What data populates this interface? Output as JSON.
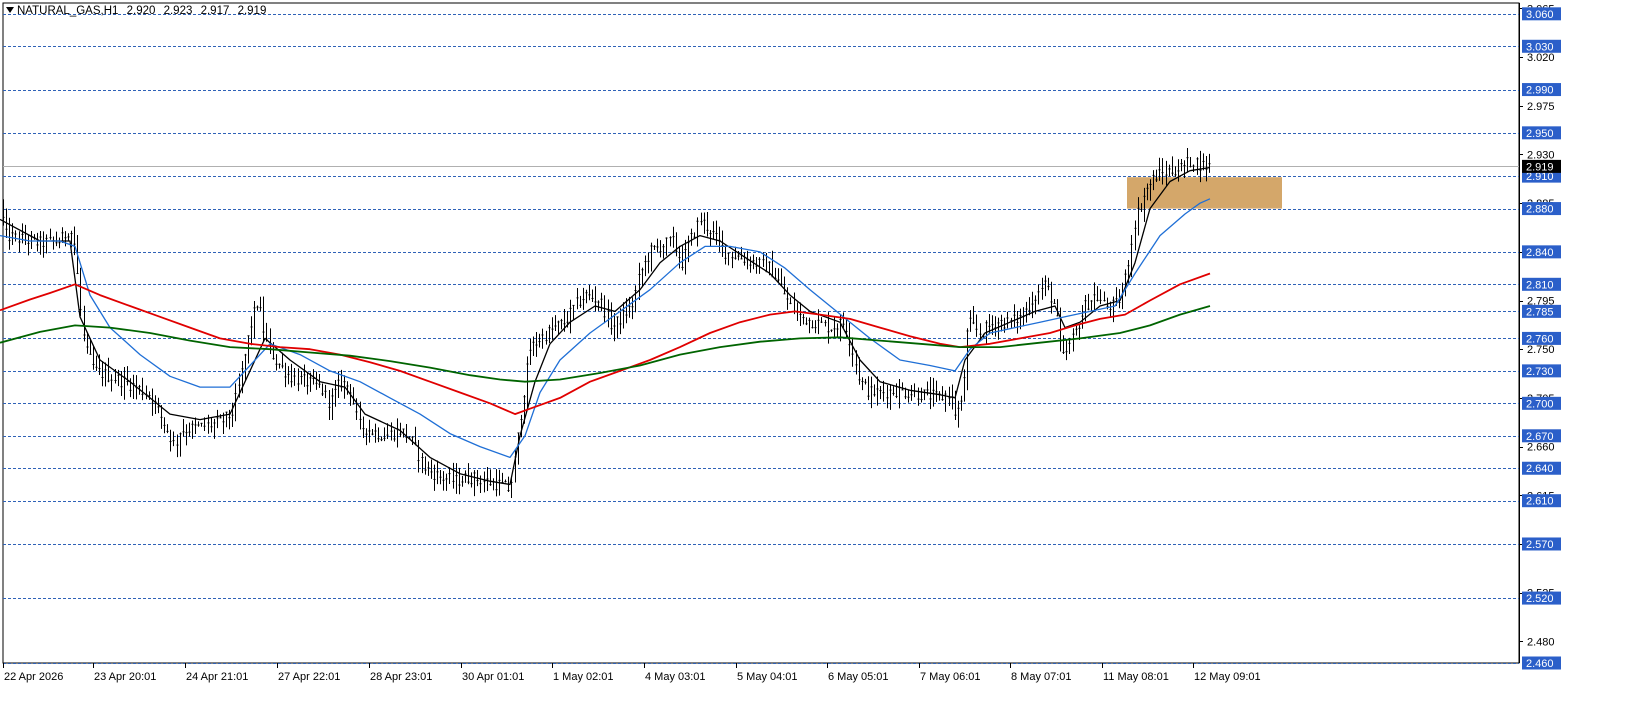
{
  "header": {
    "symbol_timeframe": "NATURAL_GAS,H1",
    "open": "2.920",
    "high": "2.923",
    "low": "2.917",
    "close": "2.919"
  },
  "colors": {
    "background": "#ffffff",
    "candles": "#000000",
    "ma_fast": "#000000",
    "ma_mid": "#1f6fd6",
    "ma_slow": "#e00000",
    "ma_long": "#006400",
    "level_lines": "#2f62b7",
    "level_label_bg": "#2b5fc9",
    "current_price_bg": "#000000",
    "zone_fill": "#d4a76a"
  },
  "chart_data": {
    "type": "candlestick",
    "ylim": [
      2.46,
      3.07
    ],
    "x_tick_labels": [
      "22 Apr 2026",
      "23 Apr 20:01",
      "24 Apr 21:01",
      "27 Apr 22:01",
      "28 Apr 23:01",
      "30 Apr 01:01",
      "1 May 02:01",
      "4 May 03:01",
      "5 May 04:01",
      "6 May 05:01",
      "7 May 06:01",
      "8 May 07:01",
      "11 May 08:01",
      "12 May 09:01"
    ],
    "y_tick_labels": [
      "3.065",
      "3.020",
      "2.975",
      "2.930",
      "2.885",
      "2.840",
      "2.795",
      "2.750",
      "2.705",
      "2.660",
      "2.615",
      "2.570",
      "2.525",
      "2.480"
    ],
    "level_labels": [
      "3.060",
      "3.030",
      "2.990",
      "2.950",
      "2.910",
      "2.880",
      "2.840",
      "2.810",
      "2.785",
      "2.760",
      "2.730",
      "2.700",
      "2.670",
      "2.640",
      "2.610",
      "2.570",
      "2.520",
      "2.460"
    ],
    "current_price": "2.919",
    "zone": {
      "x_from": 1127,
      "x_to": 1282,
      "y_from": 2.88,
      "y_to": 2.909
    },
    "price_anchors": [
      [
        0,
        2.885
      ],
      [
        6,
        2.855
      ],
      [
        20,
        2.852
      ],
      [
        40,
        2.848
      ],
      [
        60,
        2.85
      ],
      [
        70,
        2.862
      ],
      [
        75,
        2.845
      ],
      [
        80,
        2.79
      ],
      [
        85,
        2.75
      ],
      [
        95,
        2.73
      ],
      [
        110,
        2.725
      ],
      [
        130,
        2.718
      ],
      [
        150,
        2.708
      ],
      [
        165,
        2.68
      ],
      [
        175,
        2.66
      ],
      [
        180,
        2.675
      ],
      [
        200,
        2.678
      ],
      [
        220,
        2.682
      ],
      [
        232,
        2.69
      ],
      [
        240,
        2.72
      ],
      [
        250,
        2.77
      ],
      [
        258,
        2.795
      ],
      [
        265,
        2.76
      ],
      [
        275,
        2.74
      ],
      [
        290,
        2.725
      ],
      [
        305,
        2.72
      ],
      [
        320,
        2.715
      ],
      [
        330,
        2.7
      ],
      [
        340,
        2.72
      ],
      [
        350,
        2.715
      ],
      [
        358,
        2.68
      ],
      [
        370,
        2.675
      ],
      [
        385,
        2.67
      ],
      [
        400,
        2.675
      ],
      [
        410,
        2.668
      ],
      [
        425,
        2.64
      ],
      [
        440,
        2.632
      ],
      [
        455,
        2.628
      ],
      [
        470,
        2.632
      ],
      [
        485,
        2.628
      ],
      [
        500,
        2.625
      ],
      [
        510,
        2.62
      ],
      [
        515,
        2.65
      ],
      [
        522,
        2.7
      ],
      [
        530,
        2.75
      ],
      [
        540,
        2.76
      ],
      [
        555,
        2.77
      ],
      [
        565,
        2.775
      ],
      [
        575,
        2.79
      ],
      [
        585,
        2.8
      ],
      [
        600,
        2.795
      ],
      [
        612,
        2.77
      ],
      [
        622,
        2.78
      ],
      [
        632,
        2.79
      ],
      [
        640,
        2.82
      ],
      [
        650,
        2.84
      ],
      [
        660,
        2.845
      ],
      [
        672,
        2.85
      ],
      [
        682,
        2.83
      ],
      [
        690,
        2.85
      ],
      [
        700,
        2.87
      ],
      [
        710,
        2.86
      ],
      [
        725,
        2.84
      ],
      [
        740,
        2.835
      ],
      [
        755,
        2.83
      ],
      [
        770,
        2.825
      ],
      [
        780,
        2.81
      ],
      [
        790,
        2.79
      ],
      [
        800,
        2.78
      ],
      [
        815,
        2.775
      ],
      [
        830,
        2.77
      ],
      [
        845,
        2.775
      ],
      [
        852,
        2.75
      ],
      [
        860,
        2.72
      ],
      [
        870,
        2.71
      ],
      [
        880,
        2.71
      ],
      [
        895,
        2.712
      ],
      [
        910,
        2.71
      ],
      [
        925,
        2.708
      ],
      [
        940,
        2.705
      ],
      [
        950,
        2.71
      ],
      [
        955,
        2.69
      ],
      [
        962,
        2.7
      ],
      [
        968,
        2.775
      ],
      [
        980,
        2.765
      ],
      [
        995,
        2.775
      ],
      [
        1010,
        2.775
      ],
      [
        1022,
        2.78
      ],
      [
        1032,
        2.795
      ],
      [
        1045,
        2.81
      ],
      [
        1055,
        2.79
      ],
      [
        1062,
        2.74
      ],
      [
        1068,
        2.75
      ],
      [
        1075,
        2.765
      ],
      [
        1085,
        2.79
      ],
      [
        1095,
        2.8
      ],
      [
        1105,
        2.79
      ],
      [
        1115,
        2.79
      ],
      [
        1122,
        2.8
      ],
      [
        1128,
        2.83
      ],
      [
        1135,
        2.87
      ],
      [
        1145,
        2.895
      ],
      [
        1155,
        2.91
      ],
      [
        1170,
        2.915
      ],
      [
        1182,
        2.918
      ],
      [
        1192,
        2.925
      ],
      [
        1202,
        2.92
      ],
      [
        1210,
        2.919
      ]
    ],
    "series": [
      {
        "values": [
          [
            0,
            2.87
          ],
          [
            40,
            2.85
          ],
          [
            70,
            2.85
          ],
          [
            80,
            2.78
          ],
          [
            100,
            2.74
          ],
          [
            130,
            2.72
          ],
          [
            150,
            2.705
          ],
          [
            170,
            2.69
          ],
          [
            200,
            2.685
          ],
          [
            230,
            2.69
          ],
          [
            250,
            2.73
          ],
          [
            265,
            2.76
          ],
          [
            290,
            2.74
          ],
          [
            320,
            2.72
          ],
          [
            345,
            2.715
          ],
          [
            365,
            2.69
          ],
          [
            400,
            2.675
          ],
          [
            430,
            2.65
          ],
          [
            460,
            2.635
          ],
          [
            490,
            2.628
          ],
          [
            510,
            2.625
          ],
          [
            520,
            2.67
          ],
          [
            535,
            2.72
          ],
          [
            550,
            2.755
          ],
          [
            570,
            2.775
          ],
          [
            595,
            2.79
          ],
          [
            615,
            2.785
          ],
          [
            640,
            2.805
          ],
          [
            660,
            2.83
          ],
          [
            680,
            2.845
          ],
          [
            700,
            2.855
          ],
          [
            720,
            2.85
          ],
          [
            745,
            2.835
          ],
          [
            770,
            2.82
          ],
          [
            790,
            2.8
          ],
          [
            810,
            2.785
          ],
          [
            840,
            2.775
          ],
          [
            860,
            2.74
          ],
          [
            880,
            2.72
          ],
          [
            910,
            2.712
          ],
          [
            940,
            2.708
          ],
          [
            955,
            2.705
          ],
          [
            965,
            2.74
          ],
          [
            985,
            2.765
          ],
          [
            1010,
            2.775
          ],
          [
            1035,
            2.785
          ],
          [
            1055,
            2.79
          ],
          [
            1065,
            2.77
          ],
          [
            1080,
            2.775
          ],
          [
            1100,
            2.79
          ],
          [
            1120,
            2.795
          ],
          [
            1135,
            2.83
          ],
          [
            1150,
            2.88
          ],
          [
            1170,
            2.905
          ],
          [
            1190,
            2.915
          ],
          [
            1210,
            2.918
          ]
        ]
      },
      {
        "values": [
          [
            0,
            2.855
          ],
          [
            30,
            2.85
          ],
          [
            60,
            2.85
          ],
          [
            75,
            2.845
          ],
          [
            90,
            2.8
          ],
          [
            110,
            2.77
          ],
          [
            140,
            2.745
          ],
          [
            170,
            2.725
          ],
          [
            200,
            2.715
          ],
          [
            230,
            2.715
          ],
          [
            250,
            2.735
          ],
          [
            270,
            2.755
          ],
          [
            300,
            2.745
          ],
          [
            330,
            2.73
          ],
          [
            360,
            2.72
          ],
          [
            390,
            2.705
          ],
          [
            420,
            2.69
          ],
          [
            450,
            2.672
          ],
          [
            480,
            2.66
          ],
          [
            510,
            2.65
          ],
          [
            525,
            2.67
          ],
          [
            540,
            2.71
          ],
          [
            560,
            2.74
          ],
          [
            590,
            2.765
          ],
          [
            620,
            2.785
          ],
          [
            650,
            2.805
          ],
          [
            680,
            2.83
          ],
          [
            705,
            2.845
          ],
          [
            730,
            2.845
          ],
          [
            760,
            2.84
          ],
          [
            785,
            2.825
          ],
          [
            810,
            2.805
          ],
          [
            830,
            2.79
          ],
          [
            850,
            2.775
          ],
          [
            870,
            2.76
          ],
          [
            900,
            2.74
          ],
          [
            930,
            2.735
          ],
          [
            955,
            2.73
          ],
          [
            970,
            2.75
          ],
          [
            990,
            2.765
          ],
          [
            1015,
            2.77
          ],
          [
            1040,
            2.775
          ],
          [
            1065,
            2.78
          ],
          [
            1090,
            2.785
          ],
          [
            1115,
            2.79
          ],
          [
            1135,
            2.82
          ],
          [
            1160,
            2.855
          ],
          [
            1185,
            2.875
          ],
          [
            1200,
            2.885
          ],
          [
            1210,
            2.889
          ]
        ]
      },
      {
        "values": [
          [
            0,
            2.786
          ],
          [
            30,
            2.796
          ],
          [
            50,
            2.802
          ],
          [
            75,
            2.81
          ],
          [
            100,
            2.8
          ],
          [
            130,
            2.79
          ],
          [
            160,
            2.78
          ],
          [
            190,
            2.77
          ],
          [
            220,
            2.76
          ],
          [
            250,
            2.755
          ],
          [
            280,
            2.752
          ],
          [
            310,
            2.75
          ],
          [
            340,
            2.745
          ],
          [
            370,
            2.738
          ],
          [
            400,
            2.73
          ],
          [
            430,
            2.72
          ],
          [
            460,
            2.71
          ],
          [
            490,
            2.7
          ],
          [
            515,
            2.69
          ],
          [
            530,
            2.695
          ],
          [
            560,
            2.705
          ],
          [
            590,
            2.72
          ],
          [
            620,
            2.73
          ],
          [
            650,
            2.74
          ],
          [
            680,
            2.752
          ],
          [
            710,
            2.765
          ],
          [
            740,
            2.775
          ],
          [
            770,
            2.782
          ],
          [
            795,
            2.785
          ],
          [
            820,
            2.782
          ],
          [
            850,
            2.778
          ],
          [
            880,
            2.77
          ],
          [
            910,
            2.762
          ],
          [
            940,
            2.755
          ],
          [
            960,
            2.752
          ],
          [
            990,
            2.755
          ],
          [
            1020,
            2.76
          ],
          [
            1050,
            2.765
          ],
          [
            1075,
            2.772
          ],
          [
            1100,
            2.778
          ],
          [
            1125,
            2.782
          ],
          [
            1150,
            2.795
          ],
          [
            1180,
            2.81
          ],
          [
            1210,
            2.82
          ]
        ]
      },
      {
        "values": [
          [
            0,
            2.756
          ],
          [
            40,
            2.766
          ],
          [
            75,
            2.772
          ],
          [
            110,
            2.77
          ],
          [
            150,
            2.765
          ],
          [
            190,
            2.758
          ],
          [
            230,
            2.752
          ],
          [
            270,
            2.75
          ],
          [
            310,
            2.747
          ],
          [
            350,
            2.744
          ],
          [
            390,
            2.739
          ],
          [
            430,
            2.733
          ],
          [
            470,
            2.726
          ],
          [
            500,
            2.722
          ],
          [
            525,
            2.72
          ],
          [
            560,
            2.722
          ],
          [
            600,
            2.728
          ],
          [
            640,
            2.735
          ],
          [
            680,
            2.745
          ],
          [
            720,
            2.752
          ],
          [
            760,
            2.757
          ],
          [
            800,
            2.76
          ],
          [
            840,
            2.761
          ],
          [
            880,
            2.758
          ],
          [
            920,
            2.755
          ],
          [
            960,
            2.752
          ],
          [
            1000,
            2.752
          ],
          [
            1040,
            2.756
          ],
          [
            1080,
            2.76
          ],
          [
            1120,
            2.765
          ],
          [
            1150,
            2.772
          ],
          [
            1180,
            2.782
          ],
          [
            1210,
            2.79
          ]
        ]
      }
    ]
  }
}
